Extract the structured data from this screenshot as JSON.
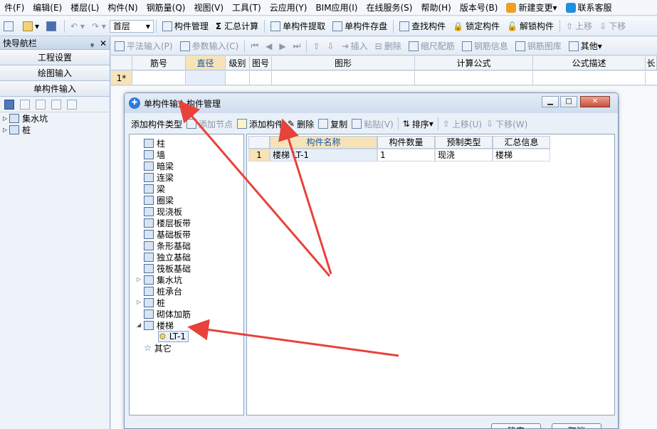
{
  "menu": [
    {
      "label": "件(F)"
    },
    {
      "label": "编辑(E)"
    },
    {
      "label": "楼层(L)"
    },
    {
      "label": "构件(N)"
    },
    {
      "label": "钢筋量(Q)"
    },
    {
      "label": "视图(V)"
    },
    {
      "label": "工具(T)"
    },
    {
      "label": "云应用(Y)"
    },
    {
      "label": "BIM应用(I)"
    },
    {
      "label": "在线服务(S)"
    },
    {
      "label": "帮助(H)"
    },
    {
      "label": "版本号(B)"
    },
    {
      "label": "新建变更",
      "icon": "new-change-icon"
    },
    {
      "label": "联系客服",
      "icon": "customer-service-icon"
    }
  ],
  "toolbar": {
    "floor": "首层",
    "component_manage": "构件管理",
    "summary_calc": "汇总计算",
    "single_extract": "单构件提取",
    "single_save": "单构件存盘",
    "find_component": "查找构件",
    "lock_component": "锁定构件",
    "unlock_component": "解锁构件",
    "move_up": "上移",
    "move_down": "下移"
  },
  "sidebar": {
    "title": "快导航栏",
    "pin": "ᵩ",
    "close": "✕",
    "nav_buttons": [
      "工程设置",
      "绘图输入",
      "单构件输入"
    ],
    "tree": [
      "集水坑",
      "桩"
    ]
  },
  "toolbar2": {
    "flat_input": "平法输入(P)",
    "param_input": "参数输入(C)",
    "insert": "插入",
    "delete": "删除",
    "scale_rebar": "缩尺配筋",
    "rebar_info": "钢筋信息",
    "rebar_library": "钢筋图库",
    "other": "其他"
  },
  "grid": {
    "headers": [
      "筋号",
      "直径(mm)",
      "级别",
      "图号",
      "图形",
      "计算公式",
      "公式描述",
      "长"
    ],
    "row_number": "1*"
  },
  "dialog": {
    "title": "单构件输入构件管理",
    "toolbar": {
      "add_type": "添加构件类型",
      "add_node": "添加节点",
      "add_component": "添加构件",
      "delete": "删除",
      "copy": "复制",
      "paste": "粘贴(V)",
      "sort": "排序",
      "move_up": "上移(U)",
      "move_down": "下移(W)"
    },
    "component_types": [
      "柱",
      "墙",
      "暗梁",
      "连梁",
      "梁",
      "圈梁",
      "现浇板",
      "楼层板带",
      "基础板带",
      "条形基础",
      "独立基础",
      "筏板基础",
      "集水坑",
      "桩承台",
      "桩",
      "砌体加筋",
      "楼梯",
      "LT-1",
      "其它"
    ],
    "table": {
      "headers": [
        "构件名称",
        "构件数量",
        "预制类型",
        "汇总信息"
      ],
      "rows": [
        {
          "index": "1",
          "name": "楼梯 LT-1",
          "count": "1",
          "precast": "现浇",
          "summary": "楼梯"
        }
      ]
    },
    "ok": "确定",
    "cancel": "取消"
  }
}
